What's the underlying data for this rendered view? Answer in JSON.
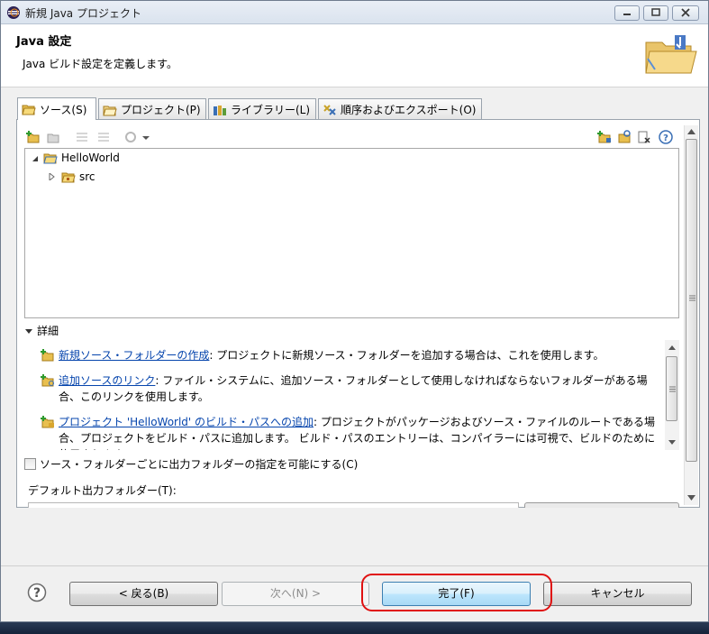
{
  "window": {
    "title": "新規 Java プロジェクト"
  },
  "header": {
    "title": "Java 設定",
    "description": "Java ビルド設定を定義します。"
  },
  "tabs": [
    {
      "label": "ソース(S)",
      "icon": "source-folder-icon",
      "active": true
    },
    {
      "label": "プロジェクト(P)",
      "icon": "project-folder-icon",
      "active": false
    },
    {
      "label": "ライブラリー(L)",
      "icon": "library-icon",
      "active": false
    },
    {
      "label": "順序およびエクスポート(O)",
      "icon": "order-export-icon",
      "active": false
    }
  ],
  "tree": {
    "project": "HelloWorld",
    "children": [
      "src"
    ]
  },
  "details": {
    "header": "詳細",
    "items": [
      {
        "link": "新規ソース・フォルダーの作成",
        "text": ": プロジェクトに新規ソース・フォルダーを追加する場合は、これを使用します。"
      },
      {
        "link": "追加ソースのリンク",
        "text": ": ファイル・システムに、追加ソース・フォルダーとして使用しなければならないフォルダーがある場合、このリンクを使用します。"
      },
      {
        "link": "プロジェクト 'HelloWorld' のビルド・パスへの追加",
        "text": ": プロジェクトがパッケージおよびソース・ファイルのルートである場合、プロジェクトをビルド・パスに追加します。 ビルド・パスのエントリーは、コンパイラーには可視で、ビルドのために使用されます。"
      }
    ]
  },
  "options": {
    "output_folder_checkbox": "ソース・フォルダーごとに出力フォルダーの指定を可能にする(C)",
    "default_output_label": "デフォルト出力フォルダー(T):"
  },
  "buttons": {
    "back": "< 戻る(B)",
    "next": "次へ(N) >",
    "finish": "完了(F)",
    "cancel": "キャンセル"
  },
  "colors": {
    "highlight": "#e01010",
    "link": "#0645ad",
    "primary_button": "#a7d9f5"
  }
}
